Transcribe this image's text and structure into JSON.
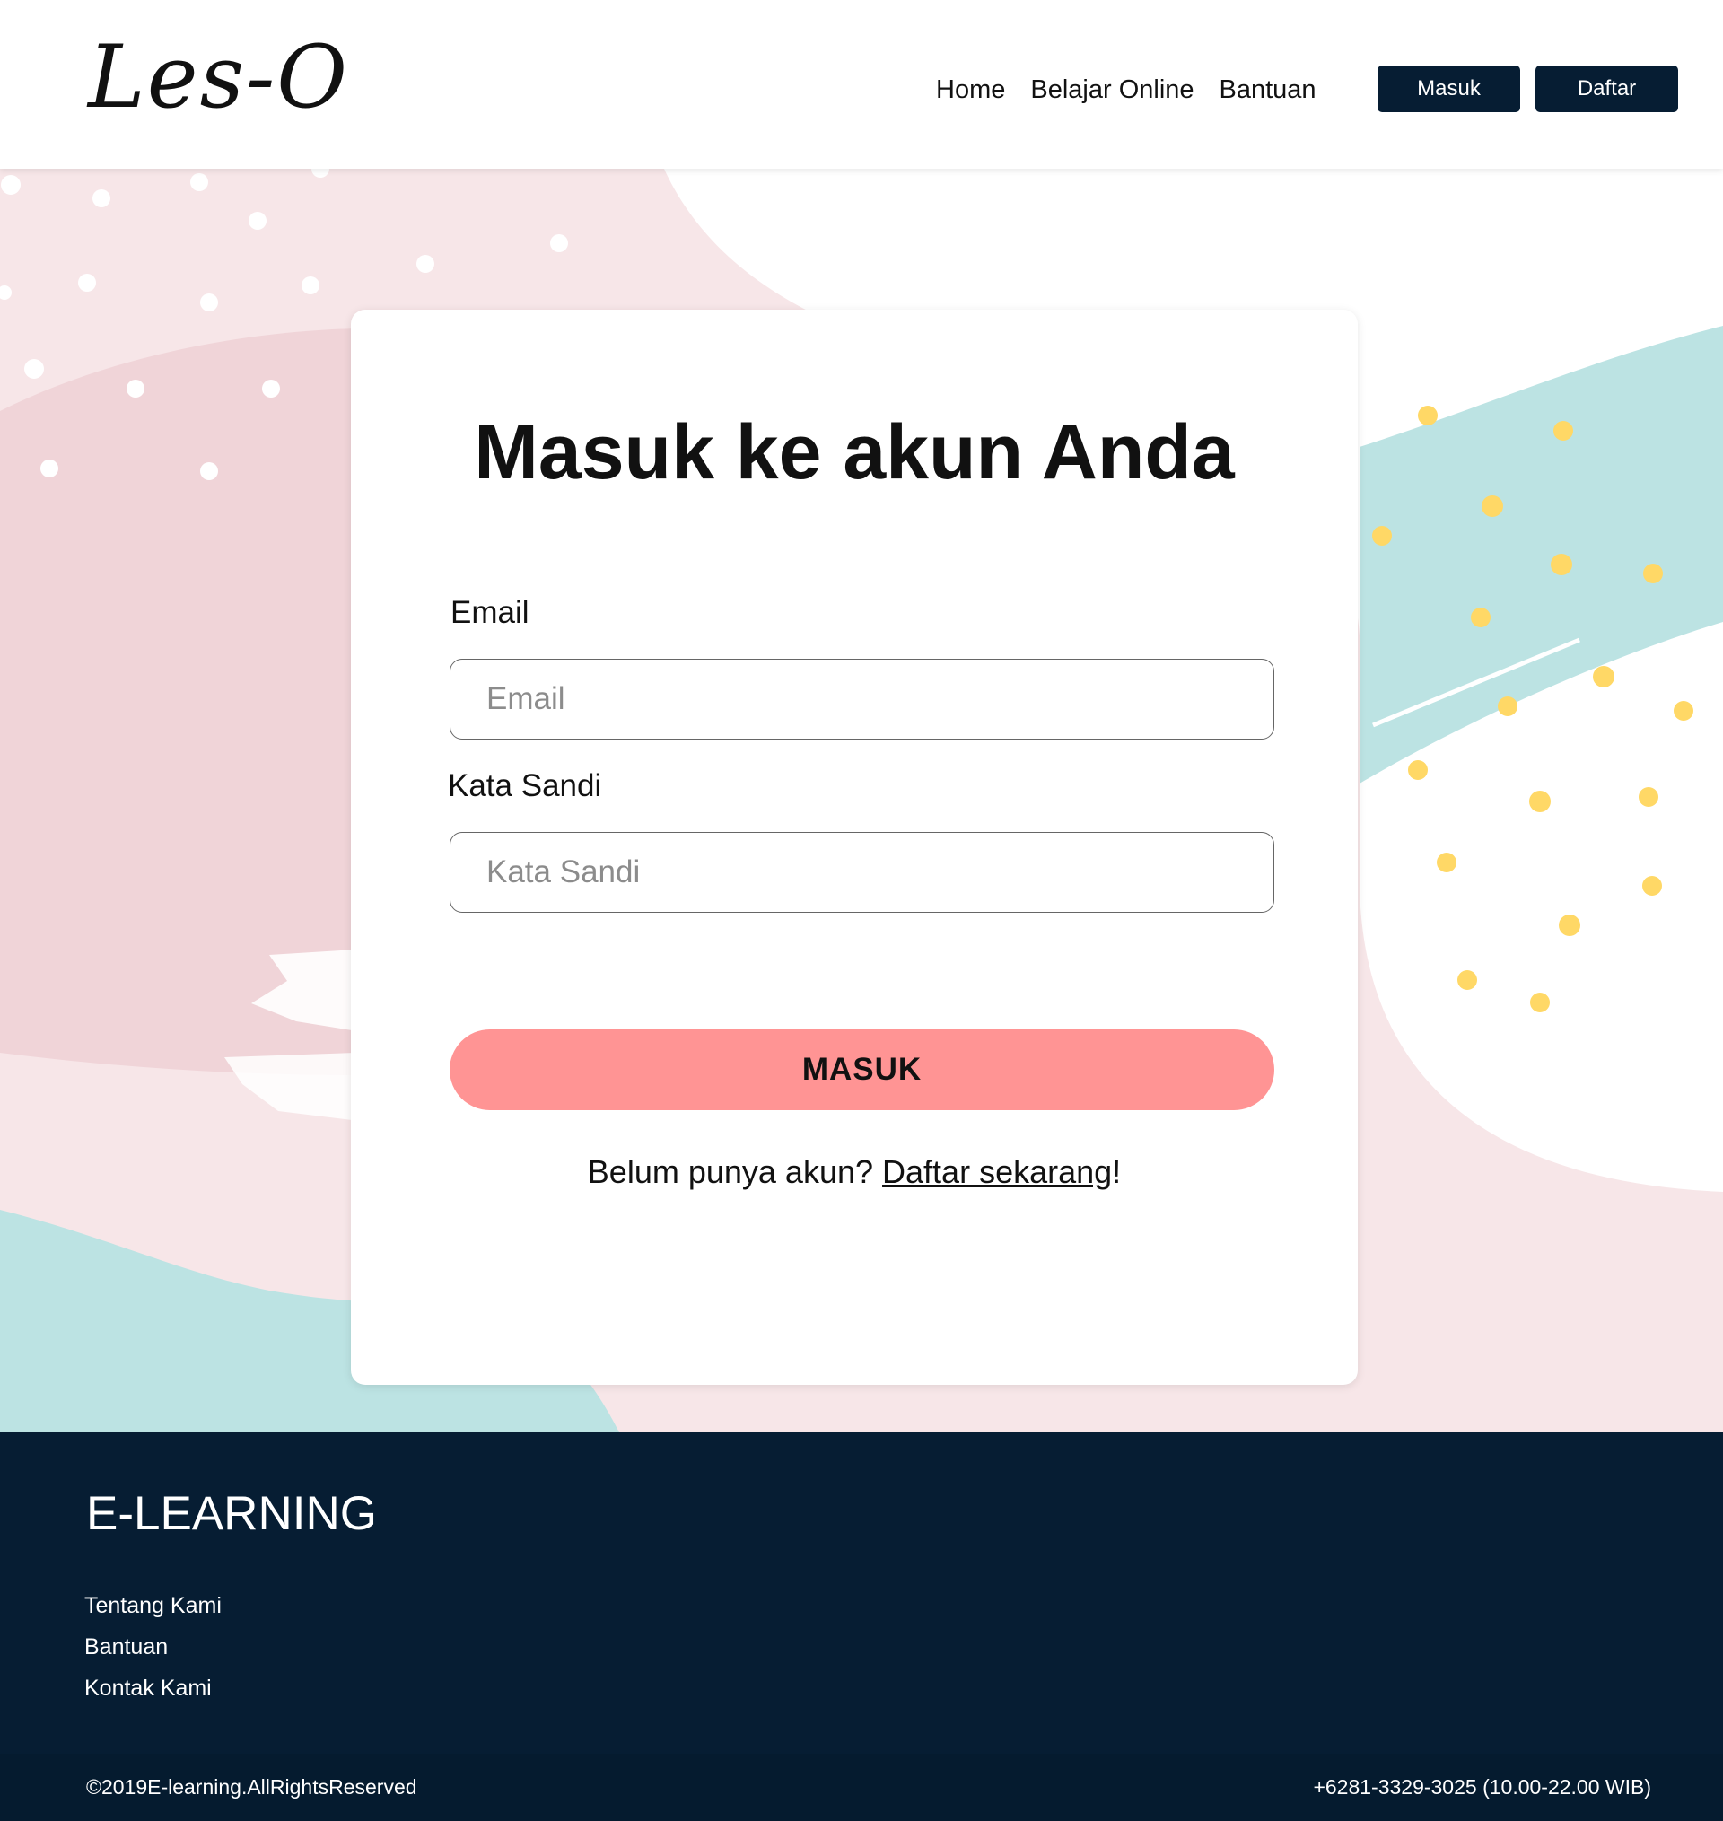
{
  "header": {
    "logo": "Les-O",
    "nav": [
      "Home",
      "Belajar Online",
      "Bantuan"
    ],
    "login_label": "Masuk",
    "register_label": "Daftar"
  },
  "login_card": {
    "title": "Masuk ke akun Anda",
    "email_label": "Email",
    "email_placeholder": "Email",
    "password_label": "Kata Sandi",
    "password_placeholder": "Kata Sandi",
    "submit_label": "MASUK",
    "signup_prompt": "Belum punya akun?",
    "signup_link": "Daftar sekarang",
    "signup_suffix": "!"
  },
  "footer": {
    "brand": "E-LEARNING",
    "links": [
      "Tentang Kami",
      "Bantuan",
      "Kontak Kami"
    ],
    "copyright": "©2019E-learning.AllRightsReserved",
    "contact": "+6281-3329-3025 (10.00-22.00 WIB)"
  },
  "colors": {
    "navy": "#061d33",
    "salmon": "#ff9494",
    "pink_light": "#f7e6e8",
    "pink_mid": "#f0d4d8",
    "teal": "#bce3e3",
    "dot_yellow": "#ffd866"
  }
}
